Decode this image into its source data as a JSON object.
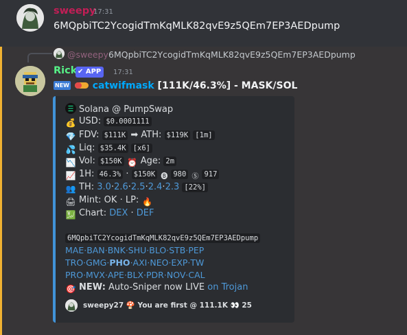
{
  "message1": {
    "username": "sweepy",
    "time": "17:31",
    "text": "6MQpbiTC2YcogidTmKqMLK82qvE9z5QEm7EP3AEDpump"
  },
  "reply": {
    "mention": "@sweepy",
    "text": "6MQpbiTC2YcogidTmKqMLK82qvE9z5QEm7EP3AEDpump"
  },
  "message2": {
    "username": "Rick",
    "badge": "✔ APP",
    "time": "17:31",
    "new_badge": "NEW",
    "token_link": "catwifmask",
    "title_rest": " [111K/46.3%] - MASK/SOL"
  },
  "embed": {
    "accent_color": "#4193d8",
    "chain": "Solana @ PumpSwap",
    "usd_label": "USD:",
    "usd_value": "$0.0001111",
    "fdv_label": "FDV:",
    "fdv_value": "$111K",
    "ath_arrow": "➡",
    "ath_label": "ATH:",
    "ath_value": "$119K",
    "ath_time": "[1m]",
    "liq_label": "Liq:",
    "liq_value": "$35.4K",
    "liq_mult": "[x6]",
    "vol_label": "Vol:",
    "vol_value": "$150K",
    "age_label": "Age:",
    "age_value": "2m",
    "h1_label": "1H:",
    "h1_pct": "46.3%",
    "h1_dot": "·",
    "h1_vol": "$150K",
    "h1_buys": "980",
    "h1_sells": "917",
    "th_label": "TH:",
    "th_values": [
      "3.0",
      "2.6",
      "2.5",
      "2.4",
      "2.3"
    ],
    "th_total": "[22%]",
    "mint_text": "Mint: OK · LP:",
    "chart_label": "Chart:",
    "chart_links": [
      "DEX",
      "DEF"
    ],
    "ca": "6MQpbiTC2YcogidTmKqMLK82qvE9z5QEm7EP3AEDpump",
    "bots_row1": [
      "MAE",
      "BAN",
      "BNK",
      "SHU",
      "BLO",
      "STB",
      "PEP"
    ],
    "bots_row2": [
      "TRO",
      "GMG",
      "PHO",
      "AXI",
      "NEO",
      "EXP",
      "TW"
    ],
    "bots_row3": [
      "PRO",
      "MVX",
      "APE",
      "BLX",
      "PDR",
      "NOV",
      "CAL"
    ],
    "promo_bold": "NEW:",
    "promo_text": " Auto-Sniper now LIVE ",
    "promo_link": "on Trojan",
    "footer": "sweepy27 🍄 You are first @ 111.1K 👀 25"
  },
  "icons": {
    "chain": "solana-icon",
    "usd": "money-bag-icon",
    "fdv": "gem-icon",
    "liq": "droplets-icon",
    "vol": "chart-down-icon",
    "age": "alarm-clock-icon",
    "h1": "chart-up-icon",
    "th": "users-icon",
    "mint": "printer-icon",
    "lp": "fire-icon",
    "chart": "chart-icon",
    "promo": "target-icon"
  }
}
